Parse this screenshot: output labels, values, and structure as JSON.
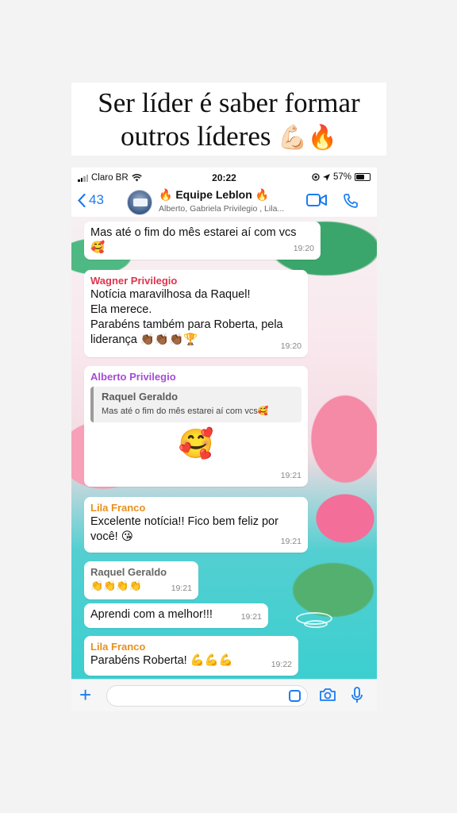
{
  "caption": {
    "line1": "Ser líder é saber formar",
    "line2": "outros líderes",
    "emoji": "💪🏻🔥"
  },
  "status_bar": {
    "carrier": "Claro BR",
    "time": "20:22",
    "battery": "57%"
  },
  "header": {
    "back_count": "43",
    "title": "🔥 Equipe Leblon 🔥",
    "subtitle": "Alberto, Gabriela Privilegio , Lila..."
  },
  "colors": {
    "accent": "#1a7cf2",
    "sender_wagner": "#e0334d",
    "sender_alberto": "#a54cd6",
    "sender_lila": "#e8901f",
    "sender_raquel": "#666666"
  },
  "messages": [
    {
      "text": "Mas até o fim do mês estarei aí com vcs",
      "emoji": "🥰",
      "time": "19:20"
    },
    {
      "sender": "Wagner Privilegio",
      "lines": [
        "Notícia maravilhosa da Raquel!",
        "Ela  merece.",
        "Parabéns também para Roberta, pela"
      ],
      "last_text": "liderança ",
      "emoji": "👏🏾👏🏾👏🏾🏆",
      "time": "19:20"
    },
    {
      "sender": "Alberto Privilegio",
      "quote_name": "Raquel Geraldo",
      "quote_text": "Mas até o fim do mês estarei aí com vcs🥰",
      "emoji": "🥰",
      "time": "19:21"
    },
    {
      "sender": "Lila Franco",
      "line1": "Excelente notícia!! Fico bem feliz por",
      "line2": "você! ",
      "emoji": "😘",
      "time": "19:21"
    },
    {
      "sender": "Raquel Geraldo",
      "emoji": "👏👏👏👏",
      "time": "19:21"
    },
    {
      "text": "Aprendi com a melhor!!!",
      "time": "19:21"
    },
    {
      "sender": "Lila Franco",
      "text": "Parabéns Roberta! ",
      "emoji": "💪💪💪",
      "time": "19:22"
    }
  ],
  "icons": {
    "header": [
      "back-chevron-icon",
      "video-call-icon",
      "phone-call-icon"
    ],
    "input": [
      "plus-icon",
      "sticker-icon",
      "camera-icon",
      "microphone-icon"
    ]
  }
}
